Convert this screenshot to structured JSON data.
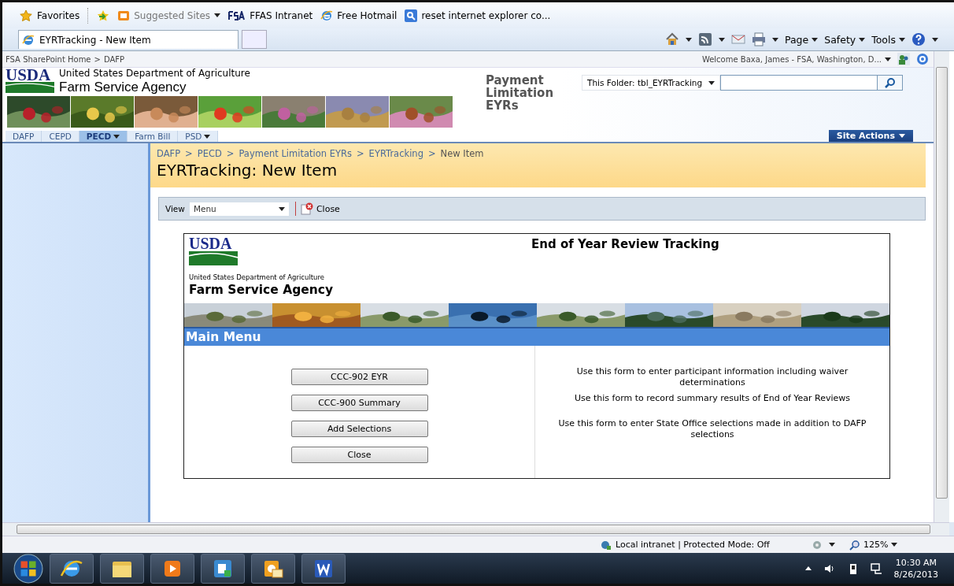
{
  "favorites_bar": {
    "label": "Favorites",
    "links": [
      {
        "label": "Suggested Sites",
        "dropdown": true
      },
      {
        "label": "FFAS Intranet",
        "dropdown": false
      },
      {
        "label": "Free Hotmail",
        "dropdown": false
      },
      {
        "label": "reset internet explorer co...",
        "dropdown": false
      }
    ]
  },
  "browser_tab": {
    "title": "EYRTracking - New Item"
  },
  "command_bar": [
    "Page",
    "Safety",
    "Tools"
  ],
  "top_bar": {
    "breadcrumb": [
      "FSA SharePoint Home",
      "DAFP"
    ],
    "separator": ">",
    "welcome": "Welcome Baxa, James - FSA, Washington, D..."
  },
  "header": {
    "logo": "USDA",
    "department": "United States Department of Agriculture",
    "agency": "Farm Service Agency",
    "site_title": "Payment Limitation EYRs",
    "search_scope": "This Folder: tbl_EYRTracking"
  },
  "nav_tabs": [
    {
      "label": "DAFP",
      "selected": false,
      "dropdown": false
    },
    {
      "label": "CEPD",
      "selected": false,
      "dropdown": false
    },
    {
      "label": "PECD",
      "selected": true,
      "dropdown": true
    },
    {
      "label": "Farm Bill",
      "selected": false,
      "dropdown": false
    },
    {
      "label": "PSD",
      "selected": false,
      "dropdown": true
    }
  ],
  "site_actions": "Site Actions",
  "page": {
    "breadcrumb": [
      "DAFP",
      "PECD",
      "Payment Limitation EYRs",
      "EYRTracking",
      "New Item"
    ],
    "separator": ">",
    "title": "EYRTracking: New Item"
  },
  "toolbar": {
    "view_label": "View",
    "view_value": "Menu",
    "close": "Close"
  },
  "form": {
    "logo": "USDA",
    "department": "United States Department of Agriculture",
    "agency": "Farm Service Agency",
    "title": "End of Year Review Tracking",
    "section": "Main Menu",
    "buttons": [
      "CCC-902 EYR",
      "CCC-900 Summary",
      "Add Selections",
      "Close"
    ],
    "descriptions": [
      "Use this form to enter participant information including waiver determinations",
      "Use this form to record summary results of End of Year Reviews",
      "Use this form to enter State Office selections made in addition to DAFP selections"
    ]
  },
  "status_bar": {
    "zone": "Local intranet | Protected Mode: Off",
    "zoom": "125%"
  },
  "taskbar": {
    "time": "10:30 AM",
    "date": "8/26/2013"
  }
}
